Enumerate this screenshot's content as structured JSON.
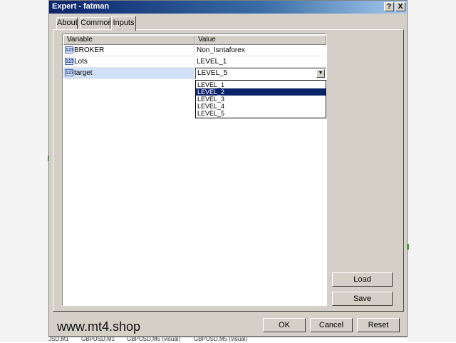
{
  "window": {
    "title": "Expert - fatman",
    "help_glyph": "?",
    "close_glyph": "X"
  },
  "tabs": [
    {
      "label": "About"
    },
    {
      "label": "Common"
    },
    {
      "label": "Inputs",
      "active": true
    }
  ],
  "table": {
    "columns": [
      "Variable",
      "Value"
    ],
    "rows": [
      {
        "variable": "BROKER",
        "value": "Non_Isntaforex",
        "type_icon": "123"
      },
      {
        "variable": "Lots",
        "value": "LEVEL_1",
        "type_icon": "123"
      },
      {
        "variable": "target",
        "value": "LEVEL_5",
        "type_icon": "123",
        "selected": true
      }
    ]
  },
  "dropdown": {
    "selected": "LEVEL_5",
    "options": [
      "LEVEL_1",
      "LEVEL_2",
      "LEVEL_3",
      "LEVEL_4",
      "LEVEL_5"
    ],
    "highlighted_index": 1
  },
  "buttons": {
    "load": "Load",
    "save": "Save",
    "ok": "OK",
    "cancel": "Cancel",
    "reset": "Reset"
  },
  "watermark": "www.mt4.shop",
  "bottom_tabs": [
    "JSD,M1",
    "GBPUSD,M1",
    "GBPUSD,M5 (visual)",
    "GBPUSD,M5 (visual)"
  ]
}
